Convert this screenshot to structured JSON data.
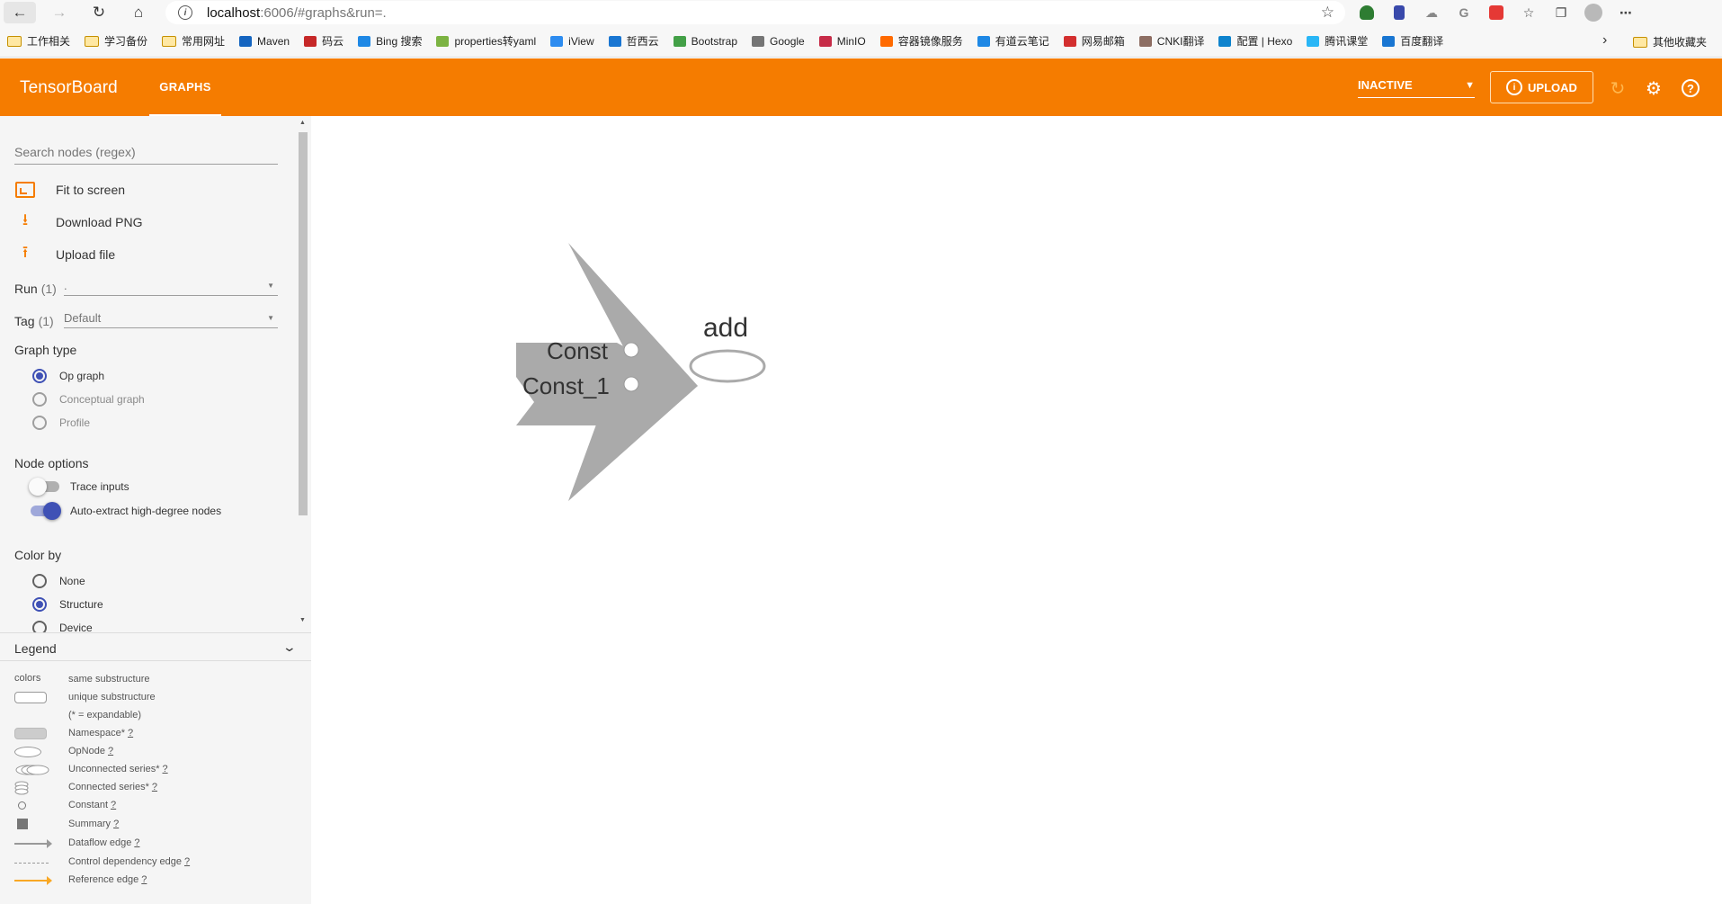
{
  "browser": {
    "url_host": "localhost",
    "url_rest": ":6006/#graphs&run=.",
    "bookmarks": [
      {
        "label": "工作相关",
        "type": "folder"
      },
      {
        "label": "学习备份",
        "type": "folder"
      },
      {
        "label": "常用网址",
        "type": "folder"
      },
      {
        "label": "Maven",
        "type": "site",
        "color": "#1565c0"
      },
      {
        "label": "码云",
        "type": "site",
        "color": "#c62828"
      },
      {
        "label": "Bing 搜索",
        "type": "site",
        "color": "#1e88e5"
      },
      {
        "label": "properties转yaml",
        "type": "site",
        "color": "#7cb342"
      },
      {
        "label": "iView",
        "type": "site",
        "color": "#2d8cf0"
      },
      {
        "label": "哲西云",
        "type": "site",
        "color": "#1976d2"
      },
      {
        "label": "Bootstrap",
        "type": "site",
        "color": "#43a047"
      },
      {
        "label": "Google",
        "type": "site",
        "color": "#757575"
      },
      {
        "label": "MinIO",
        "type": "site",
        "color": "#c72c48"
      },
      {
        "label": "容器镜像服务",
        "type": "site",
        "color": "#ff6a00"
      },
      {
        "label": "有道云笔记",
        "type": "site",
        "color": "#1e88e5"
      },
      {
        "label": "网易邮箱",
        "type": "site",
        "color": "#d32f2f"
      },
      {
        "label": "CNKI翻译",
        "type": "site",
        "color": "#8d6e63"
      },
      {
        "label": "配置 | Hexo",
        "type": "site",
        "color": "#0e83cd"
      },
      {
        "label": "腾讯课堂",
        "type": "site",
        "color": "#29b6f6"
      },
      {
        "label": "百度翻译",
        "type": "site",
        "color": "#1976d2"
      }
    ],
    "other_bookmarks": "其他收藏夹"
  },
  "header": {
    "brand": "TensorBoard",
    "tab": "GRAPHS",
    "run_status": "INACTIVE",
    "upload_label": "UPLOAD"
  },
  "sidebar": {
    "search_placeholder": "Search nodes (regex)",
    "actions": {
      "fit": "Fit to screen",
      "download": "Download PNG",
      "upload": "Upload file"
    },
    "run": {
      "label": "Run",
      "count": "(1)",
      "value": "."
    },
    "tag": {
      "label": "Tag",
      "count": "(1)",
      "value": "Default"
    },
    "graph_type": {
      "title": "Graph type",
      "options": [
        "Op graph",
        "Conceptual graph",
        "Profile"
      ],
      "selected": "Op graph"
    },
    "node_options": {
      "title": "Node options",
      "trace_inputs": "Trace inputs",
      "auto_extract": "Auto-extract high-degree nodes"
    },
    "color_by": {
      "title": "Color by",
      "options": [
        "None",
        "Structure",
        "Device"
      ],
      "selected": "Structure"
    }
  },
  "legend": {
    "title": "Legend",
    "colors_label": "colors",
    "rows": {
      "same": "same substructure",
      "unique": "unique substructure",
      "expandable": "(* = expandable)",
      "namespace": "Namespace*",
      "opnode": "OpNode",
      "unconnected": "Unconnected series*",
      "connected": "Connected series*",
      "constant": "Constant",
      "summary": "Summary",
      "dataflow": "Dataflow edge",
      "control": "Control dependency edge",
      "reference": "Reference edge"
    },
    "help_mark": "?"
  },
  "graph": {
    "nodes": [
      "Const",
      "Const_1",
      "add"
    ]
  },
  "colors": {
    "accent": "#f57c00",
    "radio_selected": "#3f51b5",
    "node_gray": "#aaaaaa"
  }
}
